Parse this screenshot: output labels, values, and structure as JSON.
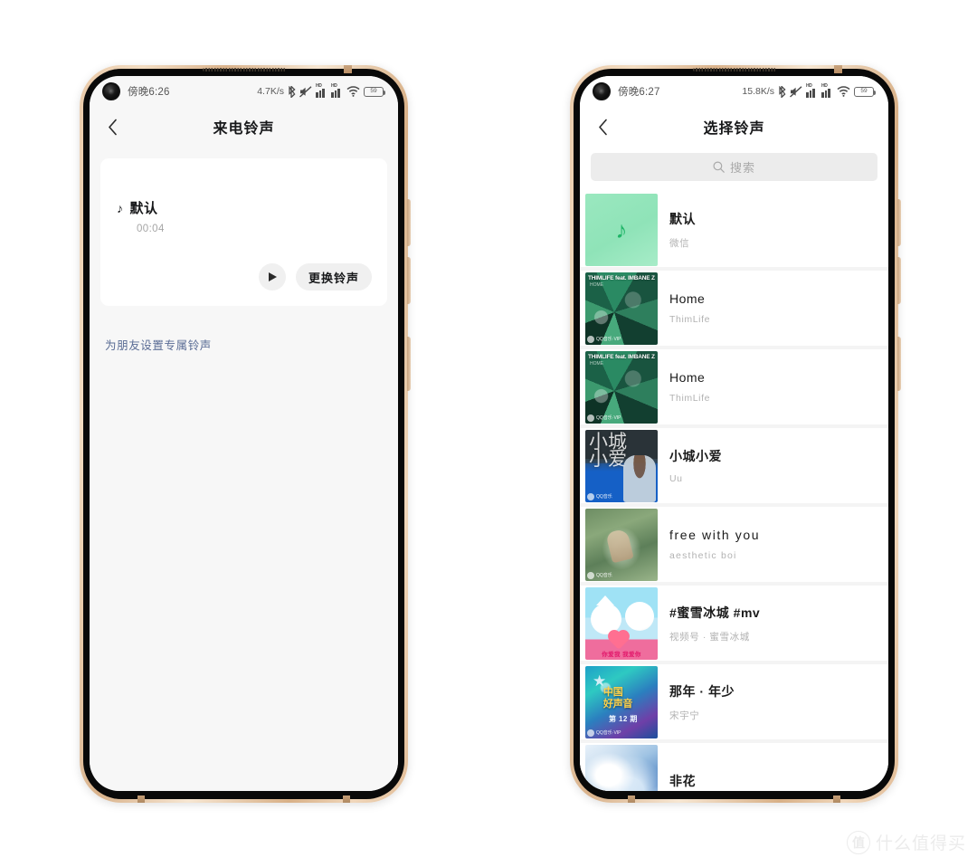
{
  "left_phone": {
    "status_bar": {
      "time": "傍晚6:26",
      "network_speed": "4.7K/s",
      "battery_level": "59",
      "icons": [
        "bluetooth-icon",
        "mute-icon",
        "signal-icon",
        "signal-icon",
        "wifi-icon",
        "battery-icon"
      ]
    },
    "nav": {
      "back_icon": "chevron-left-icon",
      "title": "来电铃声"
    },
    "ringtone_card": {
      "note_icon": "music-note-icon",
      "name": "默认",
      "duration": "00:04",
      "play_label": "play-icon",
      "change_label": "更换铃声"
    },
    "friend_link": "为朋友设置专属铃声"
  },
  "right_phone": {
    "status_bar": {
      "time": "傍晚6:27",
      "network_speed": "15.8K/s",
      "battery_level": "59",
      "icons": [
        "bluetooth-icon",
        "mute-icon",
        "signal-icon",
        "signal-icon",
        "wifi-icon",
        "battery-icon"
      ]
    },
    "nav": {
      "back_icon": "chevron-left-icon",
      "title": "选择铃声"
    },
    "search": {
      "icon": "search-icon",
      "placeholder": "搜索"
    },
    "songs": [
      {
        "title": "默认",
        "artist": "微信",
        "art": "art-default",
        "badge": "",
        "caption": "",
        "caption2": ""
      },
      {
        "title": "Home",
        "artist": "ThimLife",
        "art": "art-home",
        "badge": "QQ音乐·VIP",
        "caption": "THIMLIFE feat. IMBANE Z",
        "caption2": "HOME"
      },
      {
        "title": "Home",
        "artist": "ThimLife",
        "art": "art-home",
        "badge": "QQ音乐·VIP",
        "caption": "THIMLIFE feat. IMBANE Z",
        "caption2": "HOME"
      },
      {
        "title": "小城小爱",
        "artist": "Uu",
        "art": "art-city",
        "badge": "QQ音乐",
        "caption": "",
        "caption2": ""
      },
      {
        "title": "free with you",
        "artist": "aesthetic boi",
        "art": "art-free",
        "badge": "QQ音乐",
        "caption": "",
        "caption2": ""
      },
      {
        "title": "#蜜雪冰城 #mv",
        "artist": "视频号 · 蜜雪冰城",
        "art": "art-mv",
        "badge": "",
        "caption": "",
        "caption2": ""
      },
      {
        "title": "那年 · 年少",
        "artist": "宋宇宁",
        "art": "art-year",
        "badge": "QQ音乐·VIP",
        "caption": "",
        "caption2": ""
      },
      {
        "title": "非花",
        "artist": "",
        "art": "art-flower",
        "badge": "",
        "caption": "",
        "caption2": ""
      }
    ],
    "mv_art_text": "你爱我 我爱你",
    "year_art_text": {
      "line1": "中国",
      "line2": "好声音",
      "line3": "第 12 期"
    }
  },
  "watermark": {
    "logo": "值",
    "text": "什么值得买"
  },
  "colors": {
    "accent_link": "#5a6c95",
    "default_art": "#95e2b5",
    "note_green": "#1fb567",
    "frame_gold": "#e0bb95"
  }
}
